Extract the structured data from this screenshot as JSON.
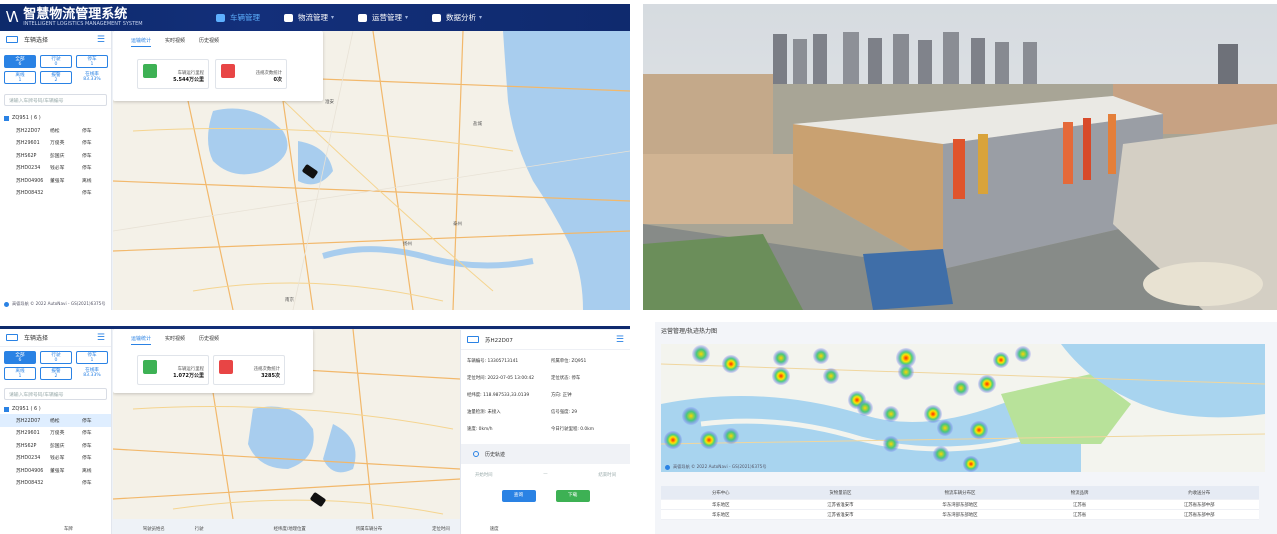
{
  "app": {
    "logo_mark": "\\/\\",
    "title": "智慧物流管理系统",
    "subtitle": "INTELLIGENT LOGISTICS MANAGEMENT SYSTEM",
    "menu": [
      {
        "label": "车辆管理",
        "active": true,
        "icon": "car-icon"
      },
      {
        "label": "物流管理",
        "active": false,
        "icon": "box-icon"
      },
      {
        "label": "运营管理",
        "active": false,
        "icon": "monitor-icon"
      },
      {
        "label": "数据分析",
        "active": false,
        "icon": "chart-icon"
      }
    ],
    "accent": "#2a82e4"
  },
  "sidebar": {
    "header": "车辆选择",
    "stats": [
      {
        "label": "全部",
        "value": "6",
        "selected": true
      },
      {
        "label": "行驶",
        "value": "0"
      },
      {
        "label": "停车",
        "value": "1"
      },
      {
        "label": "离线",
        "value": "1"
      },
      {
        "label": "报警",
        "value": "2"
      },
      {
        "label": "在线率",
        "value": "83.33%"
      }
    ],
    "search_placeholder": "请输入车牌号码/车辆编号",
    "group": "ZQ951 ( 6 )",
    "vehicles": [
      {
        "plate": "苏H22D07",
        "driver": "杨松",
        "status": "停车"
      },
      {
        "plate": "苏H29601",
        "driver": "万俊英",
        "status": "停车"
      },
      {
        "plate": "苏HS62P",
        "driver": "彭国庆",
        "status": "停车"
      },
      {
        "plate": "苏HD0234",
        "driver": "钱必军",
        "status": "停车"
      },
      {
        "plate": "苏HD04906",
        "driver": "董强军",
        "status": "离线"
      },
      {
        "plate": "苏HD08432",
        "driver": "",
        "status": "停车"
      }
    ],
    "copyright": "高德导航 © 2022 AutoNavi - GS(2021)6375号"
  },
  "map_panel_1": {
    "tabs": [
      "运输统计",
      "实时视频",
      "历史视频"
    ],
    "kpis": [
      {
        "label": "车辆运行里程",
        "value": "5.544万公里",
        "color": "#3db154"
      },
      {
        "label": "违规次数统计",
        "value": "0次",
        "color": "#e84545"
      }
    ],
    "place_labels": [
      "淮安",
      "南京",
      "扬州",
      "泰州",
      "盐城"
    ]
  },
  "map_panel_2": {
    "tabs": [
      "运输统计",
      "实时视频",
      "历史视频"
    ],
    "kpis": [
      {
        "label": "车辆运行里程",
        "value": "1.072万公里",
        "color": "#3db154"
      },
      {
        "label": "违规次数统计",
        "value": "3285次",
        "color": "#e84545"
      }
    ]
  },
  "detail": {
    "title": "苏H22D07",
    "fields": [
      {
        "label": "车辆编号:",
        "value": "13305713141"
      },
      {
        "label": "所属单位:",
        "value": "ZQ951"
      },
      {
        "label": "定位时间:",
        "value": "2022-07-05 13:00:42"
      },
      {
        "label": "定位状态:",
        "value": "停车"
      },
      {
        "label": "经纬度:",
        "value": "118.987533,33.0139"
      },
      {
        "label": "方向:",
        "value": "正钟"
      },
      {
        "label": "油量检测:",
        "value": "未接入"
      },
      {
        "label": "信号强度:",
        "value": "29"
      },
      {
        "label": "速度:",
        "value": "0km/h"
      },
      {
        "label": "今日行驶里程:",
        "value": "0.0km"
      }
    ],
    "section": "历史轨迹",
    "start_placeholder": "开始时间",
    "separator": "—",
    "end_placeholder": "结束时间",
    "query_btn": "查询",
    "download_btn": "下载"
  },
  "bottom_cols": [
    "车牌",
    "驾驶员姓名",
    "行驶",
    "经纬度/地理位置",
    "所属车辆分布",
    "定位时间",
    "速度"
  ],
  "heatmap": {
    "title": "运营管理/轨迹热力图",
    "copyright": "高德导航 © 2022 AutoNavi - GS(2021)6375号",
    "table": {
      "headers": [
        "分布中心",
        "货物量前区",
        "物流车辆分布区",
        "物流品牌",
        "约收送分布"
      ],
      "rows": [
        [
          "华东地区",
          "江苏省淮安市",
          "华东湾部东部地区",
          "江苏省",
          "江苏省东部中部"
        ],
        [
          "华东地区",
          "江苏省淮安市",
          "华东湾部东部地区",
          "江苏省",
          "江苏省东部中部"
        ]
      ]
    }
  }
}
